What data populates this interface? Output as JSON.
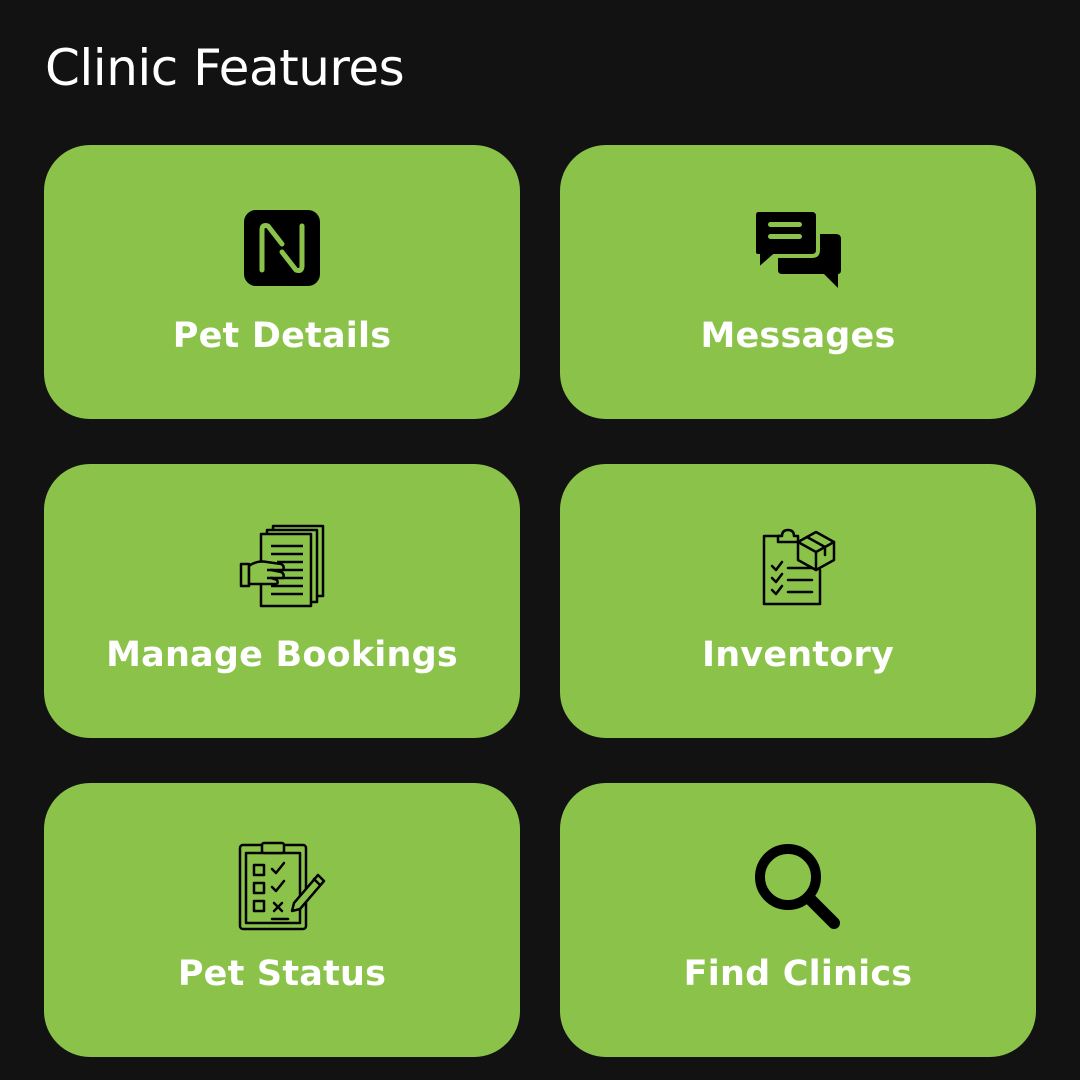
{
  "page": {
    "title": "Clinic Features"
  },
  "colors": {
    "background": "#121212",
    "card": "#8bc34a",
    "label": "#ffffff",
    "icon": "#000000"
  },
  "features": [
    {
      "label": "Pet Details",
      "icon": "nfc-icon"
    },
    {
      "label": "Messages",
      "icon": "chat-bubbles-icon"
    },
    {
      "label": "Manage Bookings",
      "icon": "hand-documents-icon"
    },
    {
      "label": "Inventory",
      "icon": "clipboard-package-icon"
    },
    {
      "label": "Pet Status",
      "icon": "clipboard-checklist-icon"
    },
    {
      "label": "Find Clinics",
      "icon": "search-icon"
    }
  ]
}
